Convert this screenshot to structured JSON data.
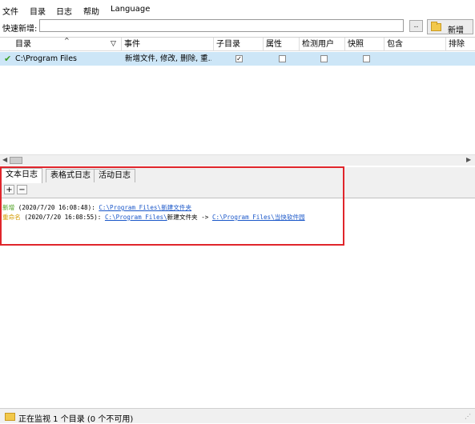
{
  "menu": [
    "文件",
    "目录",
    "日志",
    "帮助",
    "Language"
  ],
  "quick_add": {
    "label": "快速新增:",
    "value": "",
    "browse_label": "..",
    "add_label": "新增"
  },
  "table": {
    "columns": [
      "目录",
      "事件",
      "子目录",
      "属性",
      "检测用户",
      "快照",
      "包含",
      "排除"
    ],
    "rows": [
      {
        "directory": "C:\\Program Files",
        "events": "新增文件, 修改, 删除, 重...",
        "subdirs": true,
        "attributes": false,
        "detect_user": false,
        "snapshot": false
      }
    ]
  },
  "tabs": [
    "文本日志",
    "表格式日志",
    "活动日志"
  ],
  "log_toolbar": {
    "plus": "+",
    "minus": "−"
  },
  "log": [
    {
      "type": "新增",
      "type_color": "#4a9e1c",
      "time": " (2020/7/20 16:08:48): ",
      "path": "C:\\Program Files\\新建文件夹",
      "arrow": "",
      "target": ""
    },
    {
      "type": "重命名",
      "type_color": "#d39a00",
      "time": " (2020/7/20 16:08:55): ",
      "path": "C:\\Program Files\\",
      "mid": "新建文件夹 -> ",
      "target": "C:\\Program Files\\当快软件园"
    }
  ],
  "status": "正在监视 1 个目录 (0 个不可用)",
  "colors": {
    "selected_row": "#cde6f7",
    "highlight_box": "#e0252b",
    "link": "#1a57c9"
  }
}
